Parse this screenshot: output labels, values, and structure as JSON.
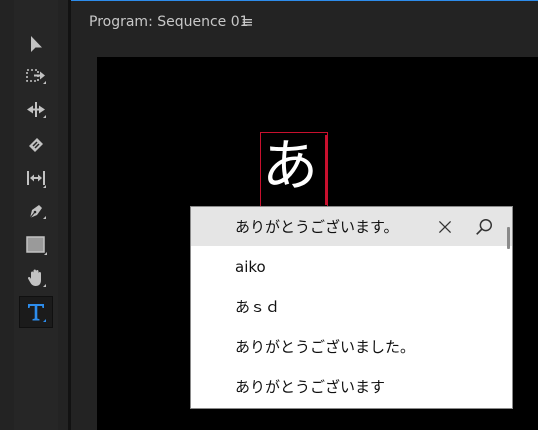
{
  "tools_panel": {
    "items": [
      {
        "name": "selection-tool",
        "icon": "arrow-pointer-icon",
        "active": false
      },
      {
        "name": "track-select-tool",
        "icon": "track-select-forward-icon",
        "active": false
      },
      {
        "name": "ripple-edit-tool",
        "icon": "ripple-edit-icon",
        "active": false
      },
      {
        "name": "razor-tool",
        "icon": "razor-icon",
        "active": false
      },
      {
        "name": "slip-tool",
        "icon": "slip-icon",
        "active": false
      },
      {
        "name": "pen-tool",
        "icon": "pen-icon",
        "active": false
      },
      {
        "name": "rectangle-tool",
        "icon": "rectangle-icon",
        "active": false
      },
      {
        "name": "hand-tool",
        "icon": "hand-icon",
        "active": false
      },
      {
        "name": "type-tool",
        "icon": "type-T-icon",
        "active": true
      }
    ]
  },
  "monitor": {
    "title": "Program: Sequence 01",
    "menu_icon": "≡",
    "text_on_canvas": "あ"
  },
  "ime_popup": {
    "candidates": [
      {
        "text": "ありがとうございます。",
        "selected": true
      },
      {
        "text": "aiko",
        "selected": false
      },
      {
        "text": "あｓｄ",
        "selected": false
      },
      {
        "text": "ありがとうございました。",
        "selected": false
      },
      {
        "text": "ありがとうございます",
        "selected": false
      }
    ],
    "close_icon": "close-icon",
    "search_icon": "search-icon"
  },
  "colors": {
    "accent_blue": "#2d8ceb",
    "text_box_red": "#c8102e",
    "active_tool": "#2d8ceb"
  }
}
